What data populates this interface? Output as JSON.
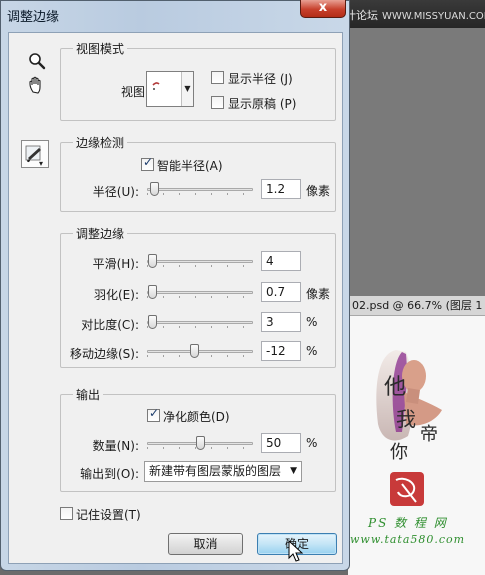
{
  "background": {
    "watermark": "思缘设计论坛",
    "watermark_url": "WWW.MISSYUAN.COM",
    "document_tab": "02.psd @ 66.7% (图层 1",
    "site_name": "PS 数 程 网",
    "site_url": "www.tata580.com",
    "close_glyph": "x"
  },
  "dialog": {
    "title": "调整边缘",
    "tools": [
      "zoom-icon",
      "hand-icon",
      "refine-radius-brush-icon"
    ],
    "view_mode": {
      "legend": "视图模式",
      "view_label": "视图:",
      "show_radius": {
        "label": "显示半径 (J)",
        "checked": false
      },
      "show_original": {
        "label": "显示原稿 (P)",
        "checked": false
      }
    },
    "edge_detection": {
      "legend": "边缘检测",
      "smart_radius": {
        "label": "智能半径(A)",
        "checked": true
      },
      "radius": {
        "label": "半径(U):",
        "value": "1.2",
        "unit": "像素",
        "fraction": 0.02
      }
    },
    "adjust_edge": {
      "legend": "调整边缘",
      "smooth": {
        "label": "平滑(H):",
        "value": "4",
        "unit": "",
        "fraction": 0.0
      },
      "feather": {
        "label": "羽化(E):",
        "value": "0.7",
        "unit": "像素",
        "fraction": 0.0
      },
      "contrast": {
        "label": "对比度(C):",
        "value": "3",
        "unit": "%",
        "fraction": 0.0
      },
      "shift_edge": {
        "label": "移动边缘(S):",
        "value": "-12",
        "unit": "%",
        "fraction": 0.44
      }
    },
    "output": {
      "legend": "输出",
      "decontaminate": {
        "label": "净化颜色(D)",
        "checked": true
      },
      "amount": {
        "label": "数量(N):",
        "value": "50",
        "unit": "%",
        "fraction": 0.5
      },
      "output_to": {
        "label": "输出到(O):",
        "selected": "新建带有图层蒙版的图层"
      }
    },
    "remember": {
      "label": "记住设置(T)",
      "checked": false
    },
    "cancel_label": "取消",
    "ok_label": "确定"
  }
}
